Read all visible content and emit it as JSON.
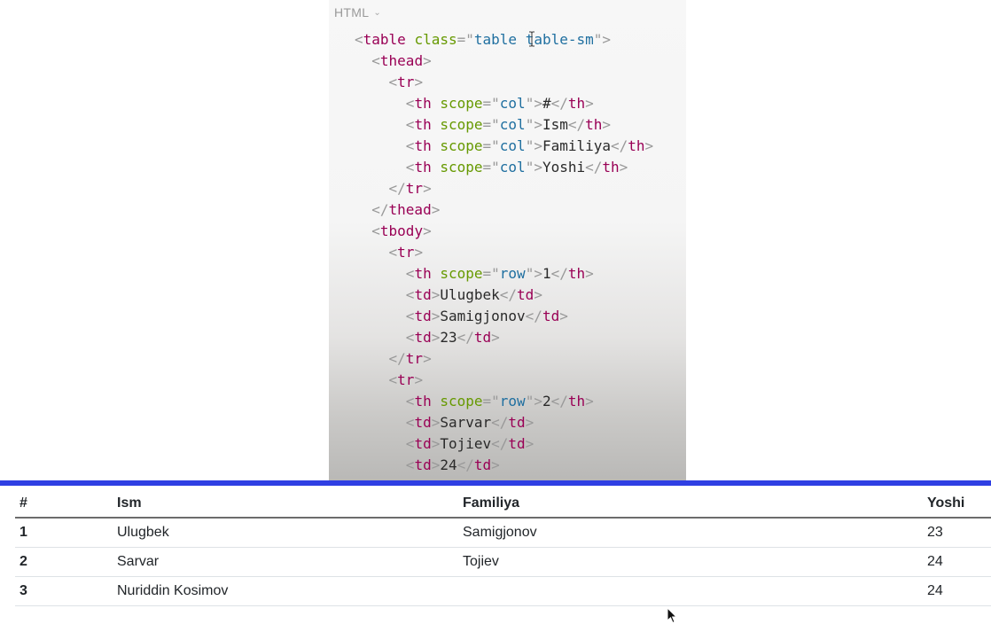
{
  "code_panel": {
    "language_label": "HTML",
    "lines": [
      {
        "indent": 0,
        "tokens": [
          [
            "p",
            "<"
          ],
          [
            "t",
            "table"
          ],
          [
            "x",
            " "
          ],
          [
            "a",
            "class"
          ],
          [
            "p",
            "=\""
          ],
          [
            "v",
            "table table-sm"
          ],
          [
            "p",
            "\">"
          ]
        ]
      },
      {
        "indent": 1,
        "tokens": [
          [
            "p",
            "<"
          ],
          [
            "t",
            "thead"
          ],
          [
            "p",
            ">"
          ]
        ]
      },
      {
        "indent": 2,
        "tokens": [
          [
            "p",
            "<"
          ],
          [
            "t",
            "tr"
          ],
          [
            "p",
            ">"
          ]
        ]
      },
      {
        "indent": 3,
        "tokens": [
          [
            "p",
            "<"
          ],
          [
            "t",
            "th"
          ],
          [
            "x",
            " "
          ],
          [
            "a",
            "scope"
          ],
          [
            "p",
            "=\""
          ],
          [
            "v",
            "col"
          ],
          [
            "p",
            "\">"
          ],
          [
            "x",
            "#"
          ],
          [
            "p",
            "</"
          ],
          [
            "t",
            "th"
          ],
          [
            "p",
            ">"
          ]
        ]
      },
      {
        "indent": 3,
        "tokens": [
          [
            "p",
            "<"
          ],
          [
            "t",
            "th"
          ],
          [
            "x",
            " "
          ],
          [
            "a",
            "scope"
          ],
          [
            "p",
            "=\""
          ],
          [
            "v",
            "col"
          ],
          [
            "p",
            "\">"
          ],
          [
            "x",
            "Ism"
          ],
          [
            "p",
            "</"
          ],
          [
            "t",
            "th"
          ],
          [
            "p",
            ">"
          ]
        ]
      },
      {
        "indent": 3,
        "tokens": [
          [
            "p",
            "<"
          ],
          [
            "t",
            "th"
          ],
          [
            "x",
            " "
          ],
          [
            "a",
            "scope"
          ],
          [
            "p",
            "=\""
          ],
          [
            "v",
            "col"
          ],
          [
            "p",
            "\">"
          ],
          [
            "x",
            "Familiya"
          ],
          [
            "p",
            "</"
          ],
          [
            "t",
            "th"
          ],
          [
            "p",
            ">"
          ]
        ]
      },
      {
        "indent": 3,
        "tokens": [
          [
            "p",
            "<"
          ],
          [
            "t",
            "th"
          ],
          [
            "x",
            " "
          ],
          [
            "a",
            "scope"
          ],
          [
            "p",
            "=\""
          ],
          [
            "v",
            "col"
          ],
          [
            "p",
            "\">"
          ],
          [
            "x",
            "Yoshi"
          ],
          [
            "p",
            "</"
          ],
          [
            "t",
            "th"
          ],
          [
            "p",
            ">"
          ]
        ]
      },
      {
        "indent": 2,
        "tokens": [
          [
            "p",
            "</"
          ],
          [
            "t",
            "tr"
          ],
          [
            "p",
            ">"
          ]
        ]
      },
      {
        "indent": 1,
        "tokens": [
          [
            "p",
            "</"
          ],
          [
            "t",
            "thead"
          ],
          [
            "p",
            ">"
          ]
        ]
      },
      {
        "indent": 1,
        "tokens": [
          [
            "p",
            "<"
          ],
          [
            "t",
            "tbody"
          ],
          [
            "p",
            ">"
          ]
        ]
      },
      {
        "indent": 2,
        "tokens": [
          [
            "p",
            "<"
          ],
          [
            "t",
            "tr"
          ],
          [
            "p",
            ">"
          ]
        ]
      },
      {
        "indent": 3,
        "tokens": [
          [
            "p",
            "<"
          ],
          [
            "t",
            "th"
          ],
          [
            "x",
            " "
          ],
          [
            "a",
            "scope"
          ],
          [
            "p",
            "=\""
          ],
          [
            "v",
            "row"
          ],
          [
            "p",
            "\">"
          ],
          [
            "x",
            "1"
          ],
          [
            "p",
            "</"
          ],
          [
            "t",
            "th"
          ],
          [
            "p",
            ">"
          ]
        ]
      },
      {
        "indent": 3,
        "tokens": [
          [
            "p",
            "<"
          ],
          [
            "t",
            "td"
          ],
          [
            "p",
            ">"
          ],
          [
            "x",
            "Ulugbek"
          ],
          [
            "p",
            "</"
          ],
          [
            "t",
            "td"
          ],
          [
            "p",
            ">"
          ]
        ]
      },
      {
        "indent": 3,
        "tokens": [
          [
            "p",
            "<"
          ],
          [
            "t",
            "td"
          ],
          [
            "p",
            ">"
          ],
          [
            "x",
            "Samigjonov"
          ],
          [
            "p",
            "</"
          ],
          [
            "t",
            "td"
          ],
          [
            "p",
            ">"
          ]
        ]
      },
      {
        "indent": 3,
        "tokens": [
          [
            "p",
            "<"
          ],
          [
            "t",
            "td"
          ],
          [
            "p",
            ">"
          ],
          [
            "x",
            "23"
          ],
          [
            "p",
            "</"
          ],
          [
            "t",
            "td"
          ],
          [
            "p",
            ">"
          ]
        ]
      },
      {
        "indent": 2,
        "tokens": [
          [
            "p",
            "</"
          ],
          [
            "t",
            "tr"
          ],
          [
            "p",
            ">"
          ]
        ]
      },
      {
        "indent": 2,
        "tokens": [
          [
            "p",
            "<"
          ],
          [
            "t",
            "tr"
          ],
          [
            "p",
            ">"
          ]
        ]
      },
      {
        "indent": 3,
        "tokens": [
          [
            "p",
            "<"
          ],
          [
            "t",
            "th"
          ],
          [
            "x",
            " "
          ],
          [
            "a",
            "scope"
          ],
          [
            "p",
            "=\""
          ],
          [
            "v",
            "row"
          ],
          [
            "p",
            "\">"
          ],
          [
            "x",
            "2"
          ],
          [
            "p",
            "</"
          ],
          [
            "t",
            "th"
          ],
          [
            "p",
            ">"
          ]
        ]
      },
      {
        "indent": 3,
        "tokens": [
          [
            "p",
            "<"
          ],
          [
            "t",
            "td"
          ],
          [
            "p",
            ">"
          ],
          [
            "x",
            "Sarvar"
          ],
          [
            "p",
            "</"
          ],
          [
            "t",
            "td"
          ],
          [
            "p",
            ">"
          ]
        ]
      },
      {
        "indent": 3,
        "tokens": [
          [
            "p",
            "<"
          ],
          [
            "t",
            "td"
          ],
          [
            "p",
            ">"
          ],
          [
            "x",
            "Tojiev"
          ],
          [
            "p",
            "</"
          ],
          [
            "t",
            "td"
          ],
          [
            "p",
            ">"
          ]
        ]
      },
      {
        "indent": 3,
        "tokens": [
          [
            "p",
            "<"
          ],
          [
            "t",
            "td"
          ],
          [
            "p",
            ">"
          ],
          [
            "x",
            "24"
          ],
          [
            "p",
            "</"
          ],
          [
            "t",
            "td"
          ],
          [
            "p",
            ">"
          ]
        ]
      }
    ]
  },
  "table": {
    "headers": [
      "#",
      "Ism",
      "Familiya",
      "Yoshi"
    ],
    "rows": [
      [
        "1",
        "Ulugbek",
        "Samigjonov",
        "23"
      ],
      [
        "2",
        "Sarvar",
        "Tojiev",
        "24"
      ],
      [
        "3",
        "Nuriddin Kosimov",
        "",
        "24"
      ]
    ]
  },
  "colors": {
    "separator": "#2f3fe3",
    "tag": "#990055",
    "attr_name": "#669900",
    "attr_value": "#1f6fa0",
    "punctuation": "#999999"
  },
  "icons": {
    "lang_dropdown": "chevron-down-icon",
    "text_cursor": "text-cursor-icon",
    "pointer": "mouse-pointer-icon"
  }
}
